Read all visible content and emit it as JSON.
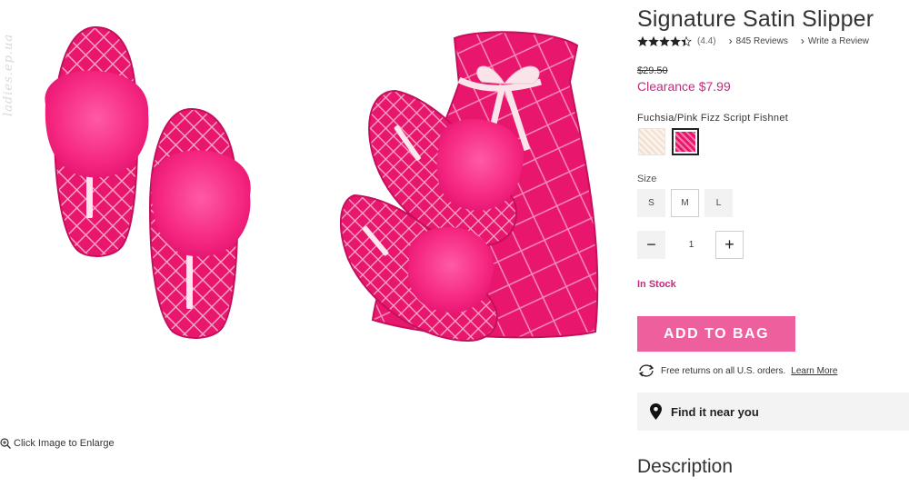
{
  "watermark": "ladies.ep.ua",
  "gallery": {
    "enlarge_label": "Click Image to Enlarge"
  },
  "product": {
    "title": "Signature Satin Slipper",
    "rating_value": "(4.4)",
    "rating_stars": 4.4,
    "reviews_link": "845 Reviews",
    "write_review_link": "Write a Review",
    "price_original": "$29.50",
    "price_clearance": "Clearance $7.99",
    "color_selected": "Fuchsia/Pink Fizz Script Fishnet",
    "size_label": "Size",
    "sizes": [
      "S",
      "M",
      "L"
    ],
    "quantity": "1",
    "qty_minus": "−",
    "qty_plus": "+",
    "stock_status": "In Stock",
    "add_to_bag": "ADD TO BAG",
    "returns_text": "Free returns on all U.S. orders.",
    "returns_link": "Learn More",
    "find_near": "Find it near you",
    "description_heading": "Description"
  },
  "colors": {
    "accent": "#c52a7e",
    "button": "#ee5f9e",
    "product_pink": "#e8176d"
  }
}
